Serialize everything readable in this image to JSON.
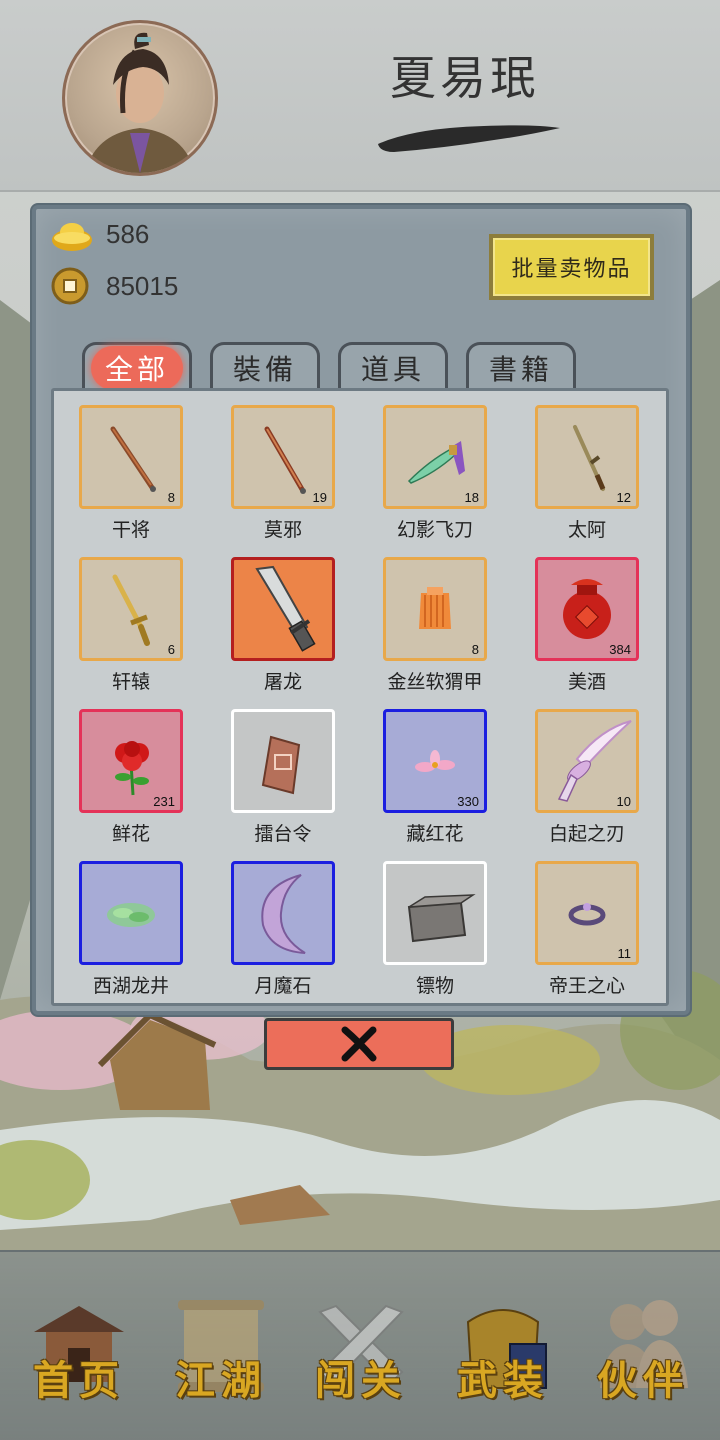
{
  "player": {
    "name": "夏易珉"
  },
  "currency": {
    "gold": "586",
    "coins": "85015"
  },
  "buttons": {
    "bulk_sell": "批量卖物品"
  },
  "tabs": [
    {
      "label": "全部",
      "active": true
    },
    {
      "label": "裝備",
      "active": false
    },
    {
      "label": "道具",
      "active": false
    },
    {
      "label": "書籍",
      "active": false
    }
  ],
  "items": [
    {
      "name": "干将",
      "count": "8",
      "rarity": "orange",
      "icon": "sword-icon"
    },
    {
      "name": "莫邪",
      "count": "19",
      "rarity": "orange",
      "icon": "sword-icon"
    },
    {
      "name": "幻影飞刀",
      "count": "18",
      "rarity": "orange",
      "icon": "flying-knife-icon"
    },
    {
      "name": "太阿",
      "count": "12",
      "rarity": "orange",
      "icon": "sword-icon"
    },
    {
      "name": "轩辕",
      "count": "6",
      "rarity": "orange",
      "icon": "golden-sword-icon"
    },
    {
      "name": "屠龙",
      "count": "",
      "rarity": "selected",
      "icon": "broadsword-icon"
    },
    {
      "name": "金丝软猬甲",
      "count": "8",
      "rarity": "orange",
      "icon": "armor-icon"
    },
    {
      "name": "美酒",
      "count": "384",
      "rarity": "red",
      "icon": "wine-jar-icon"
    },
    {
      "name": "鲜花",
      "count": "231",
      "rarity": "red",
      "icon": "flower-icon"
    },
    {
      "name": "擂台令",
      "count": "",
      "rarity": "white",
      "icon": "token-icon"
    },
    {
      "name": "藏红花",
      "count": "330",
      "rarity": "blue",
      "icon": "saffron-icon"
    },
    {
      "name": "白起之刃",
      "count": "10",
      "rarity": "orange",
      "icon": "curved-blade-icon"
    },
    {
      "name": "西湖龙井",
      "count": "",
      "rarity": "blue",
      "icon": "tea-icon"
    },
    {
      "name": "月魔石",
      "count": "",
      "rarity": "blue",
      "icon": "moonstone-icon"
    },
    {
      "name": "镖物",
      "count": "",
      "rarity": "white",
      "icon": "cargo-box-icon"
    },
    {
      "name": "帝王之心",
      "count": "11",
      "rarity": "orange",
      "icon": "ring-icon"
    }
  ],
  "nav": [
    {
      "label": "首页",
      "icon": "house-icon"
    },
    {
      "label": "江湖",
      "icon": "scroll-icon"
    },
    {
      "label": "闯关",
      "icon": "crossed-swords-icon"
    },
    {
      "label": "武装",
      "icon": "armor-book-icon"
    },
    {
      "label": "伙伴",
      "icon": "companions-icon"
    }
  ],
  "colors": {
    "rarity_orange": "#e8a84a",
    "rarity_red": "#e43258",
    "rarity_blue": "#1b1ee0",
    "rarity_white": "#ffffff",
    "active_tab": "#ec6a5a",
    "sell_button": "#e8d44c",
    "close_button": "#ec6e5a",
    "nav_label": "#d9a722"
  }
}
